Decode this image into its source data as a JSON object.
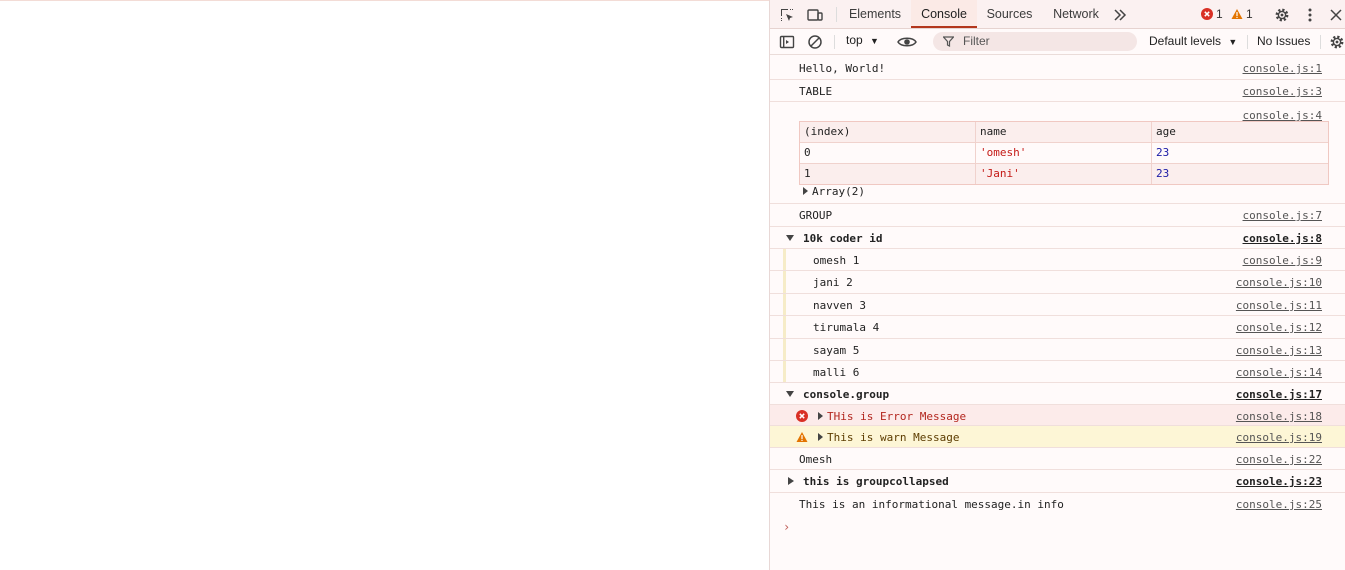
{
  "tabs": [
    {
      "label": "Elements"
    },
    {
      "label": "Console"
    },
    {
      "label": "Sources"
    },
    {
      "label": "Network"
    }
  ],
  "counters": {
    "errors": "1",
    "warnings": "1"
  },
  "toolbar": {
    "context": "top",
    "filter_placeholder": "Filter",
    "levels": "Default levels",
    "issues": "No Issues"
  },
  "console": {
    "hello": {
      "text": "Hello, World!",
      "src": "console.js:1"
    },
    "table_label": {
      "text": "TABLE",
      "src": "console.js:3"
    },
    "table_src": "console.js:4",
    "table": {
      "headers": [
        "(index)",
        "name",
        "age"
      ],
      "rows": [
        [
          "0",
          "'omesh'",
          "23"
        ],
        [
          "1",
          "'Jani'",
          "23"
        ]
      ],
      "array_label": "Array(2)"
    },
    "group_label": {
      "text": "GROUP",
      "src": "console.js:7"
    },
    "group1": {
      "title": "10k coder id",
      "src": "console.js:8"
    },
    "group1_items": [
      {
        "text": "omesh 1",
        "src": "console.js:9"
      },
      {
        "text": "jani 2",
        "src": "console.js:10"
      },
      {
        "text": "navven 3",
        "src": "console.js:11"
      },
      {
        "text": "tirumala 4",
        "src": "console.js:12"
      },
      {
        "text": "sayam 5",
        "src": "console.js:13"
      },
      {
        "text": "malli 6",
        "src": "console.js:14"
      }
    ],
    "group2": {
      "title": "console.group",
      "src": "console.js:17"
    },
    "error_msg": {
      "text": "THis is Error Message",
      "src": "console.js:18"
    },
    "warn_msg": {
      "text": "This is warn Message",
      "src": "console.js:19"
    },
    "omesh": {
      "text": "Omesh",
      "src": "console.js:22"
    },
    "collapsed": {
      "title": "this is groupcollapsed",
      "src": "console.js:23"
    },
    "info": {
      "text": "This is an informational message.in info",
      "src": "console.js:25"
    },
    "prompt": "›"
  },
  "colors": {
    "error": "#d93025",
    "warning": "#e37400",
    "accent": "#b3361c"
  }
}
